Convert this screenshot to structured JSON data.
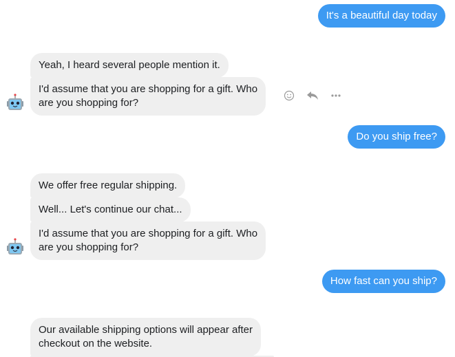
{
  "conversation": {
    "messages": [
      {
        "sender": "user",
        "text": "It's a beautiful day today"
      },
      {
        "sender": "bot",
        "text": "Yeah, I heard several people mention it."
      },
      {
        "sender": "bot",
        "text": "I'd assume that you are shopping for a gift. Who are you shopping for?",
        "lines": [
          "I'd assume that you are shopping for a gift. Who",
          "are you shopping for?"
        ]
      },
      {
        "sender": "user",
        "text": "Do you ship free?"
      },
      {
        "sender": "bot",
        "text": "We offer free regular shipping."
      },
      {
        "sender": "bot",
        "text": "Well... Let's continue our chat..."
      },
      {
        "sender": "bot",
        "text": "I'd assume that you are shopping for a gift. Who are you shopping for?",
        "lines": [
          "I'd assume that you are shopping for a gift. Who",
          "are you shopping for?"
        ]
      },
      {
        "sender": "user",
        "text": "How fast can you ship?"
      },
      {
        "sender": "bot",
        "text": "Our available shipping options will appear after checkout on the website.",
        "lines": [
          "Our available shipping options will appear after",
          "checkout on the website."
        ]
      }
    ],
    "message_actions": {
      "icons": [
        "emoji-icon",
        "reply-icon",
        "more-icon"
      ]
    }
  },
  "colors": {
    "user_bubble": "#3d9af2",
    "bot_bubble": "#efefef",
    "action_icon": "#9a9a9a"
  }
}
